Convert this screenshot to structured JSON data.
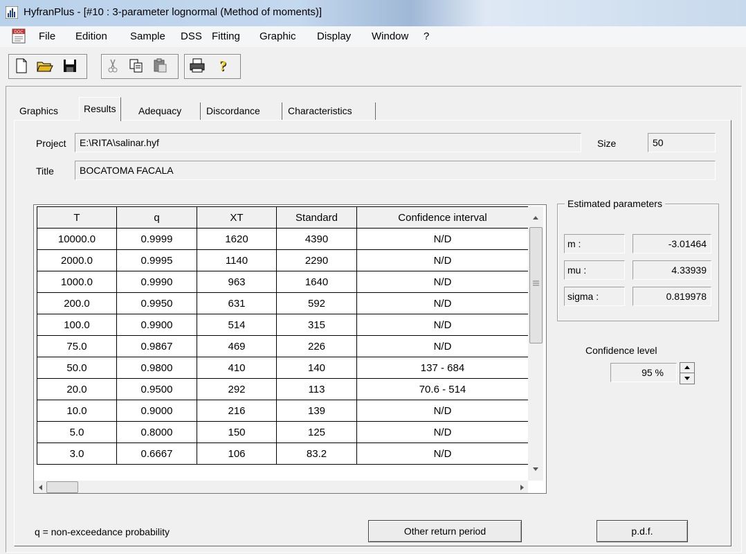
{
  "window": {
    "title": "HyfranPlus - [#10 : 3-parameter lognormal (Method of moments)]"
  },
  "menu": [
    "File",
    "Edition",
    "Sample",
    "DSS",
    "Fitting",
    "Graphic",
    "Display",
    "Window",
    "?"
  ],
  "toolbar": {
    "icons": [
      "new-document-icon",
      "open-folder-icon",
      "save-icon",
      "cut-icon",
      "copy-icon",
      "paste-icon",
      "print-icon",
      "help-icon"
    ]
  },
  "tabs": [
    "Graphics",
    "Results",
    "Adequacy",
    "Discordance",
    "Characteristics"
  ],
  "project": {
    "label": "Project",
    "value": "E:\\RITA\\salinar.hyf"
  },
  "size": {
    "label": "Size",
    "value": "50"
  },
  "title": {
    "label": "Title",
    "value": "BOCATOMA FACALA"
  },
  "table": {
    "headers": [
      "T",
      "q",
      "XT",
      "Standard",
      "Confidence interval"
    ],
    "rows": [
      [
        "10000.0",
        "0.9999",
        "1620",
        "4390",
        "N/D"
      ],
      [
        "2000.0",
        "0.9995",
        "1140",
        "2290",
        "N/D"
      ],
      [
        "1000.0",
        "0.9990",
        "963",
        "1640",
        "N/D"
      ],
      [
        "200.0",
        "0.9950",
        "631",
        "592",
        "N/D"
      ],
      [
        "100.0",
        "0.9900",
        "514",
        "315",
        "N/D"
      ],
      [
        "75.0",
        "0.9867",
        "469",
        "226",
        "N/D"
      ],
      [
        "50.0",
        "0.9800",
        "410",
        "140",
        "137 - 684"
      ],
      [
        "20.0",
        "0.9500",
        "292",
        "113",
        "70.6 - 514"
      ],
      [
        "10.0",
        "0.9000",
        "216",
        "139",
        "N/D"
      ],
      [
        "5.0",
        "0.8000",
        "150",
        "125",
        "N/D"
      ],
      [
        "3.0",
        "0.6667",
        "106",
        "83.2",
        "N/D"
      ]
    ]
  },
  "estimated": {
    "caption": "Estimated parameters",
    "params": [
      {
        "name": "m :",
        "value": "-3.01464"
      },
      {
        "name": "mu :",
        "value": "4.33939"
      },
      {
        "name": "sigma :",
        "value": "0.819978"
      }
    ]
  },
  "confidence": {
    "label": "Confidence level",
    "value": "95 %"
  },
  "footer": {
    "note": "q = non-exceedance probability",
    "other_button": "Other return period",
    "pdf_button": "p.d.f."
  }
}
